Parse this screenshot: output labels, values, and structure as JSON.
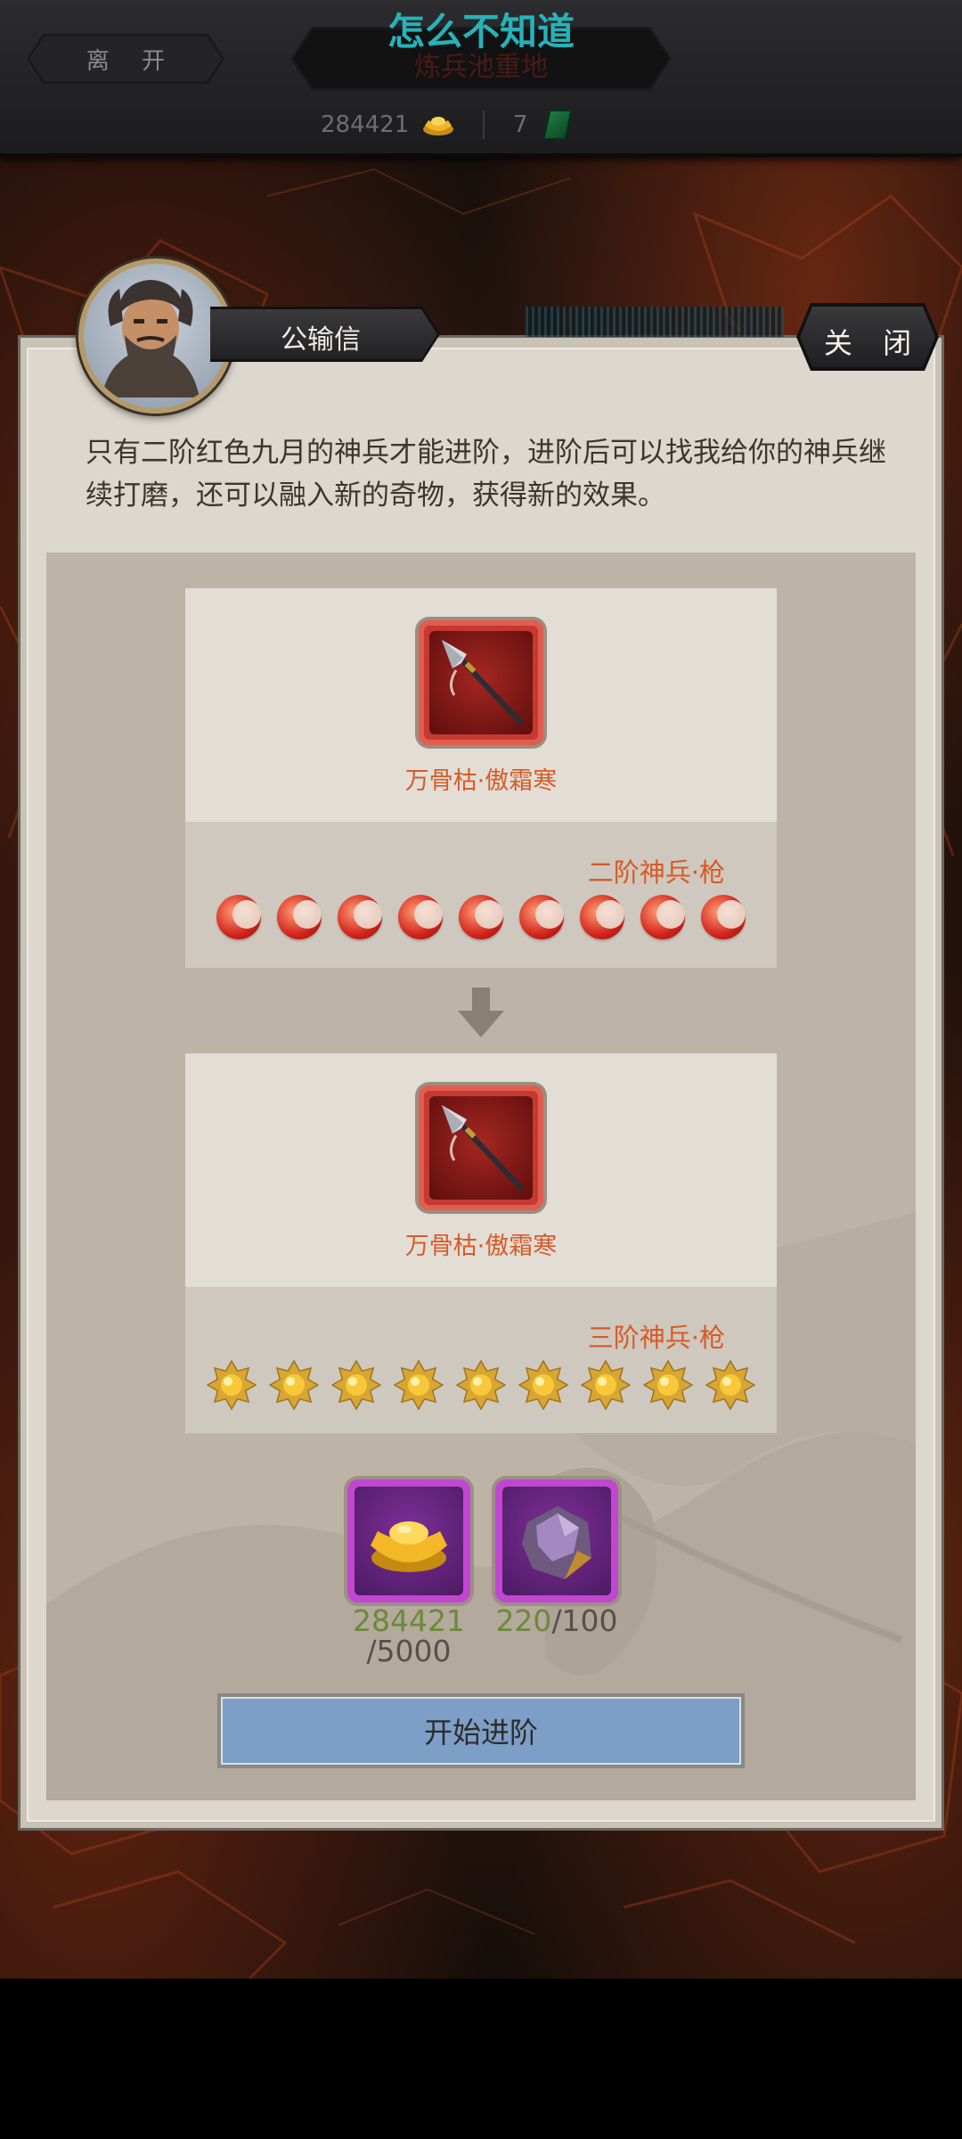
{
  "overlay_title": "怎么不知道",
  "header": {
    "leave_label": "离 开",
    "location_title": "炼兵池重地",
    "gold_amount": "284421",
    "jade_amount": "7"
  },
  "npc": {
    "name": "公输信",
    "close_label": "关 闭",
    "dialogue": "只有二阶红色九月的神兵才能进阶，进阶后可以找我给你的神兵继续打磨，还可以融入新的奇物，获得新的效果。"
  },
  "current_weapon": {
    "name": "万骨枯·傲霜寒",
    "rank": "二阶神兵·枪",
    "mark_type": "red-moon",
    "mark_count": 9
  },
  "upgraded_weapon": {
    "name": "万骨枯·傲霜寒",
    "rank": "三阶神兵·枪",
    "mark_type": "gold-sun",
    "mark_count": 9
  },
  "materials": [
    {
      "icon": "gold-ingot-icon",
      "have": "284421",
      "need": "/5000"
    },
    {
      "icon": "purple-ore-icon",
      "have": "220",
      "need": "/100"
    }
  ],
  "start_button_label": "开始进阶",
  "colors": {
    "accent_title": "#25b3b9",
    "rank_text": "#d85a28",
    "enough_amount": "#6a8a3a",
    "button_face": "#7d9ec6"
  }
}
